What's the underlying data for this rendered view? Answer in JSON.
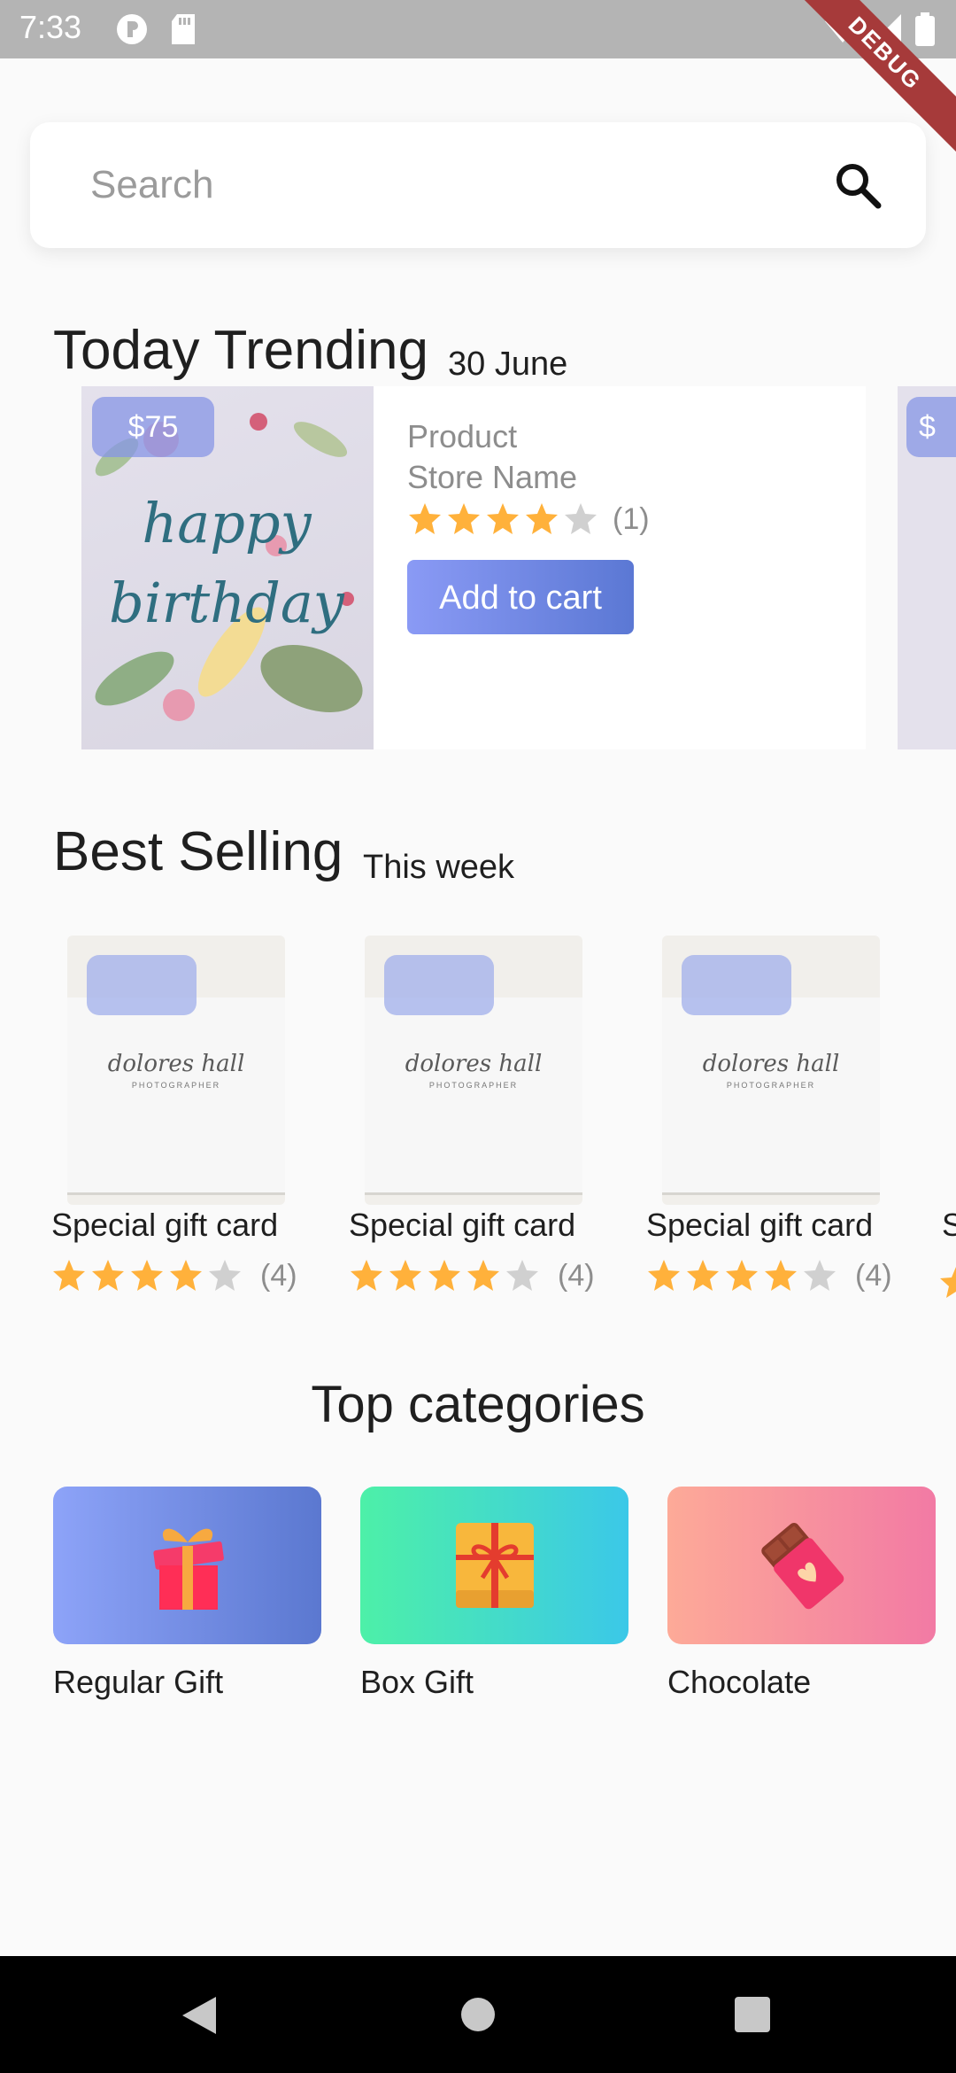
{
  "status_bar": {
    "time": "7:33",
    "debug_label": "DEBUG"
  },
  "search": {
    "placeholder": "Search",
    "icon": "search-icon"
  },
  "trending": {
    "title": "Today Trending",
    "date": "30 June",
    "card": {
      "price": "$75",
      "product": "Product",
      "store": "Store Name",
      "rating": 4,
      "rating_count": "(1)",
      "button_label": "Add to cart",
      "image_text": "happy birthday"
    },
    "next_card_price": "$"
  },
  "best_selling": {
    "title": "Best Selling",
    "subtitle": "This week",
    "items": [
      {
        "name": "Special  gift card",
        "rating": 4,
        "rating_count": "(4)",
        "card_text": "dolores hall",
        "card_subtext": "PHOTOGRAPHER"
      },
      {
        "name": "Special  gift card",
        "rating": 4,
        "rating_count": "(4)",
        "card_text": "dolores hall",
        "card_subtext": "PHOTOGRAPHER"
      },
      {
        "name": "Special  gift card",
        "rating": 4,
        "rating_count": "(4)",
        "card_text": "dolores hall",
        "card_subtext": "PHOTOGRAPHER"
      }
    ],
    "next_item_initial": "S"
  },
  "top_categories": {
    "title": "Top categories",
    "items": [
      {
        "label": "Regular Gift",
        "icon": "gift-icon",
        "gradient": [
          "#8da3f8",
          "#5b78d0"
        ]
      },
      {
        "label": "Box Gift",
        "icon": "gift-box-icon",
        "gradient": [
          "#4df0a8",
          "#3bc8e8"
        ]
      },
      {
        "label": "Chocolate",
        "icon": "chocolate-icon",
        "gradient": [
          "#fdaa98",
          "#f27aa4"
        ]
      }
    ]
  },
  "colors": {
    "star": "#ffb13b",
    "star_empty": "#d0d0d0",
    "accent": "#6f86e4"
  }
}
